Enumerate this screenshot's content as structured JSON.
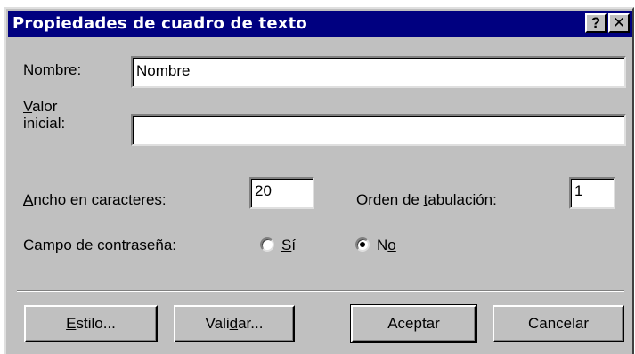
{
  "window": {
    "title": "Propiedades de cuadro de texto",
    "help_button": "?",
    "close_button": "✕"
  },
  "fields": {
    "nombre": {
      "label_first": "N",
      "label_rest": "ombre:",
      "value": "Nombre"
    },
    "valor": {
      "label_first": "V",
      "label_rest": "alor",
      "label_line2": "inicial:",
      "value": ""
    },
    "ancho": {
      "label_first": "A",
      "label_rest": "ncho en caracteres:",
      "value": "20"
    },
    "orden": {
      "label_pre": "Orden de ",
      "label_key": "t",
      "label_post": "abulación:",
      "value": "1"
    }
  },
  "password": {
    "label": "Campo de contraseña:",
    "options": [
      {
        "key": "S",
        "rest": "í",
        "selected": false
      },
      {
        "key": "o",
        "pre": "N",
        "selected": true
      }
    ]
  },
  "buttons": {
    "estilo_key": "E",
    "estilo_rest": "stilo...",
    "validar_pre": "Vali",
    "validar_key": "d",
    "validar_post": "ar...",
    "aceptar": "Aceptar",
    "cancelar": "Cancelar"
  },
  "colors": {
    "titlebar": "#000080",
    "face": "#c0c0c0"
  }
}
